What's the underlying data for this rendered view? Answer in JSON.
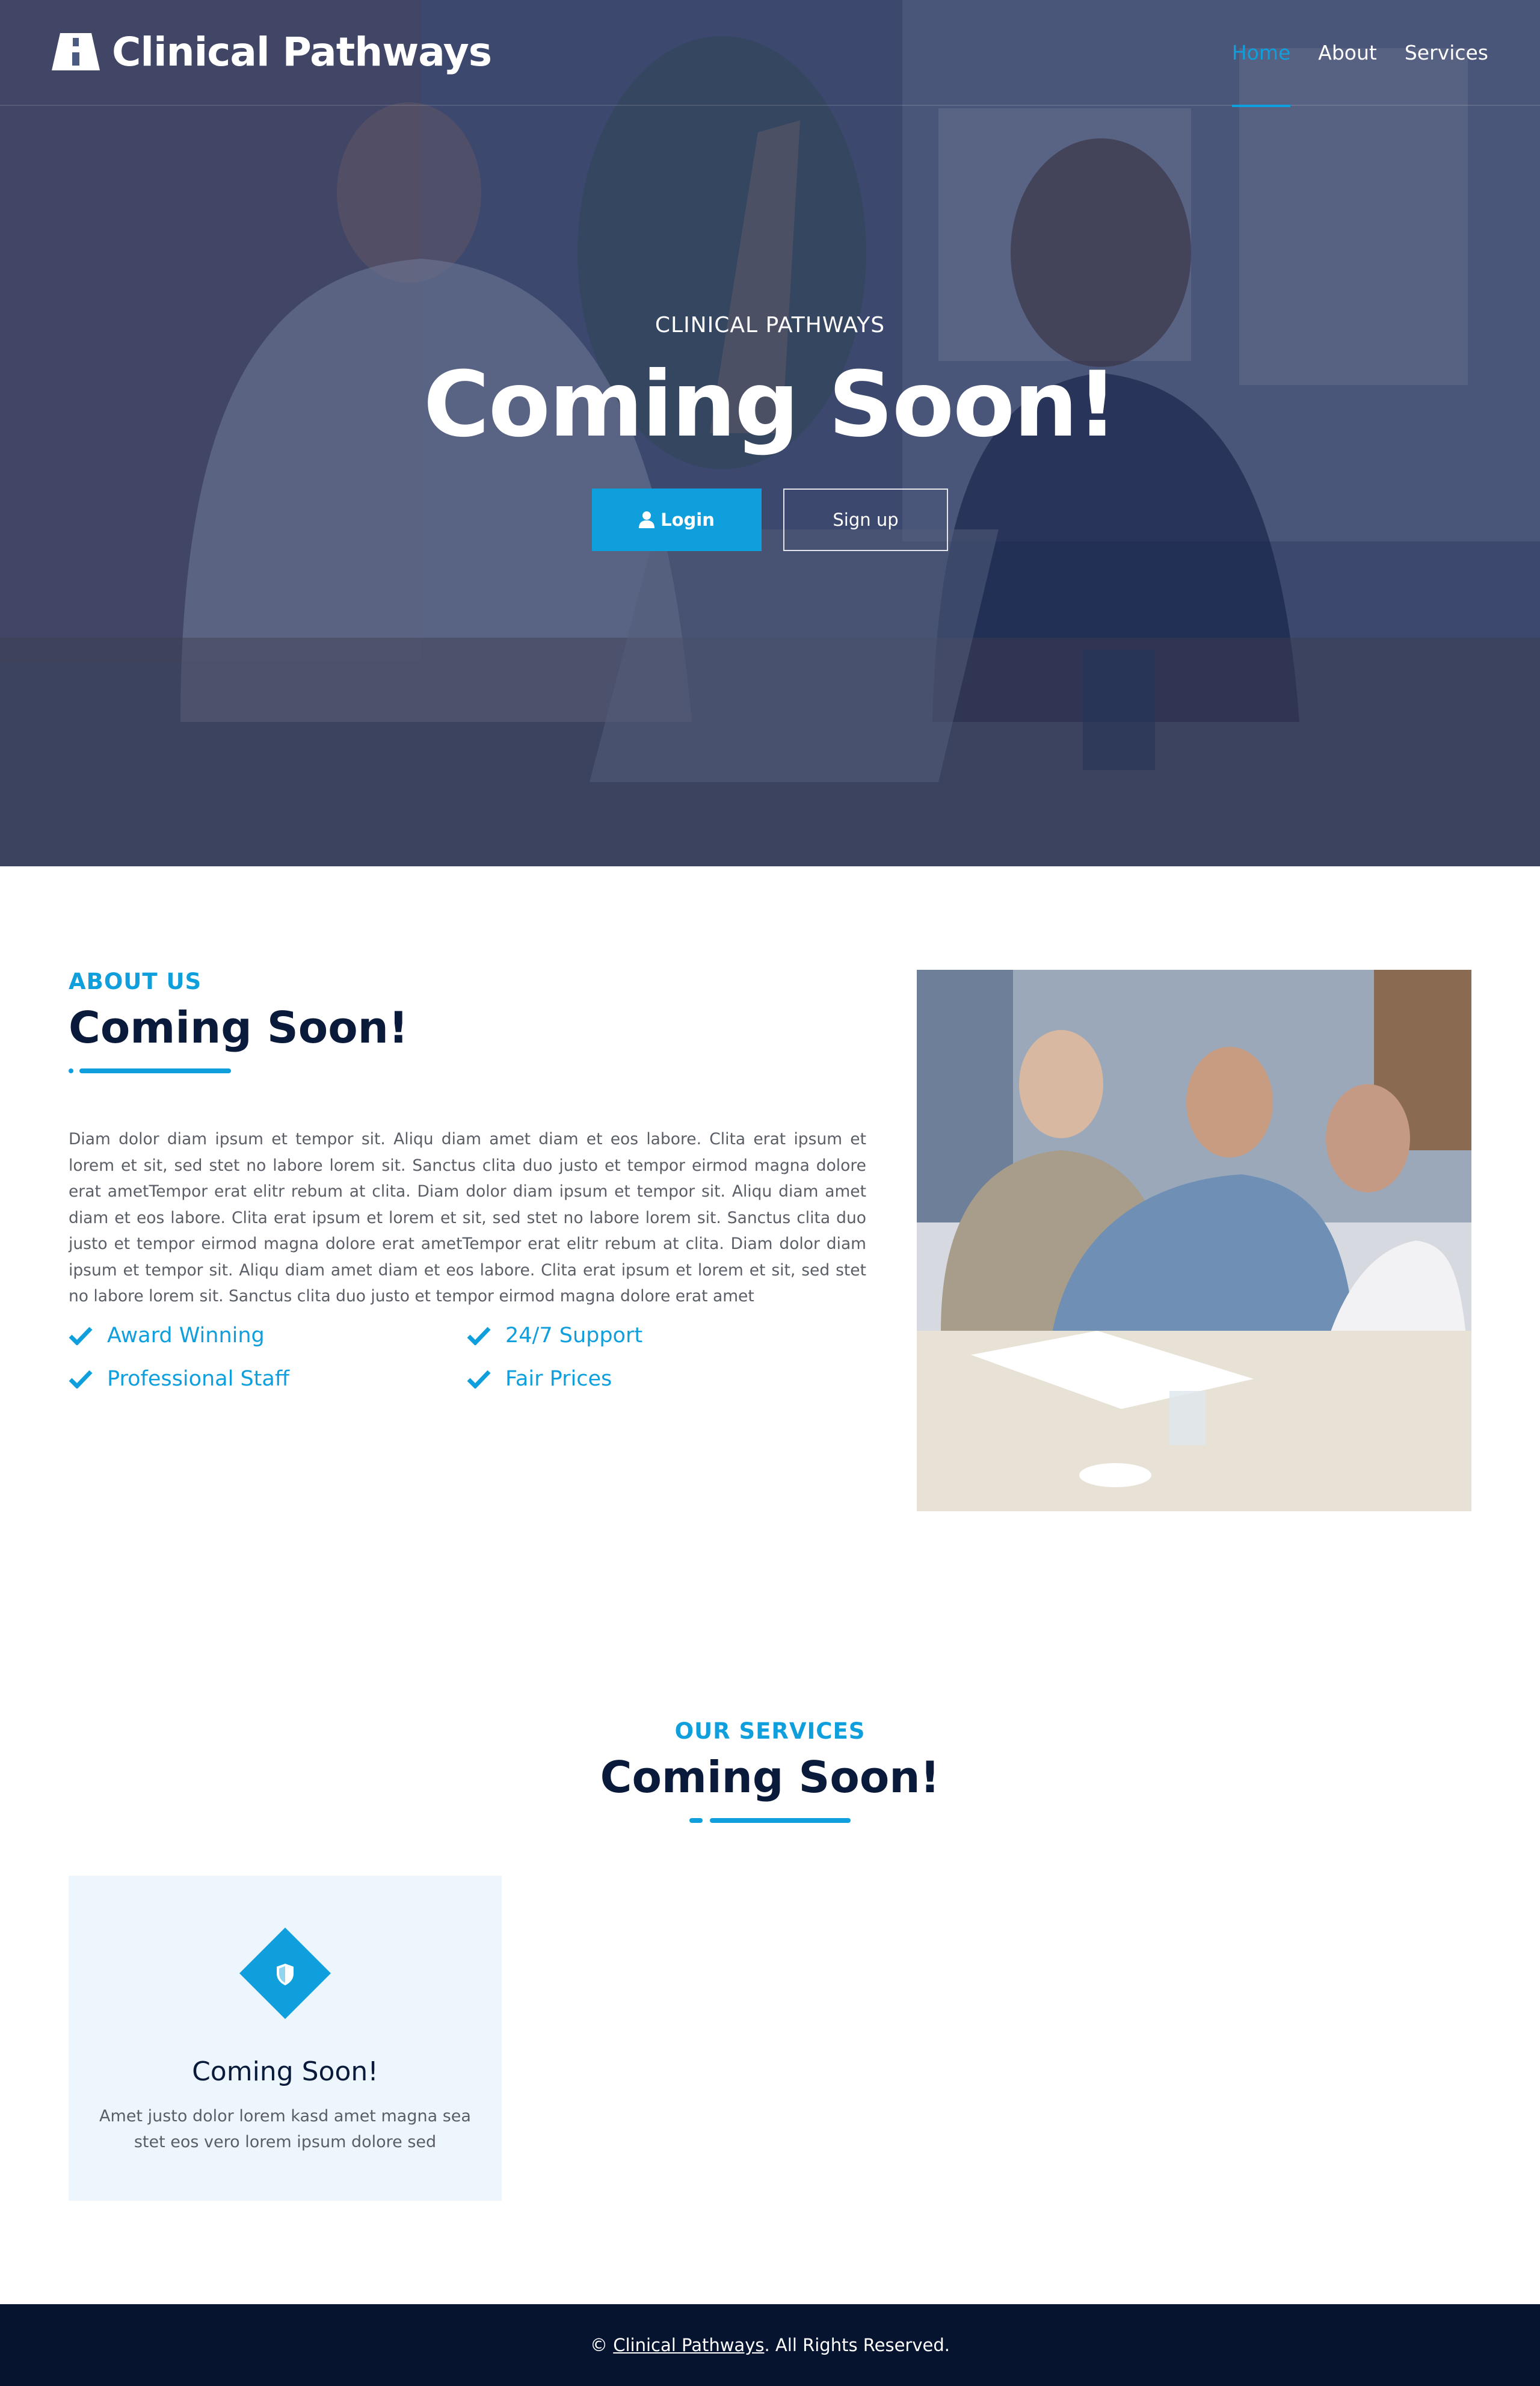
{
  "brand": {
    "name": "Clinical Pathways",
    "icon": "road-icon"
  },
  "nav": {
    "items": [
      {
        "label": "Home",
        "active": true
      },
      {
        "label": "About",
        "active": false
      },
      {
        "label": "Services",
        "active": false
      }
    ]
  },
  "hero": {
    "kicker": "CLINICAL PATHWAYS",
    "title": "Coming Soon!",
    "login_label": "Login",
    "login_icon": "user-icon",
    "signup_label": "Sign up"
  },
  "about": {
    "kicker": "ABOUT US",
    "title": "Coming Soon!",
    "text": "Diam dolor diam ipsum et tempor sit. Aliqu diam amet diam et eos labore. Clita erat ipsum et lorem et sit, sed stet no labore lorem sit. Sanctus clita duo justo et tempor eirmod magna dolore erat ametTempor erat elitr rebum at clita. Diam dolor diam ipsum et tempor sit. Aliqu diam amet diam et eos labore. Clita erat ipsum et lorem et sit, sed stet no labore lorem sit. Sanctus clita duo justo et tempor eirmod magna dolore erat ametTempor erat elitr rebum at clita. Diam dolor diam ipsum et tempor sit. Aliqu diam amet diam et eos labore. Clita erat ipsum et lorem et sit, sed stet no labore lorem sit. Sanctus clita duo justo et tempor eirmod magna dolore erat amet",
    "features": [
      "Award Winning",
      "24/7 Support",
      "Professional Staff",
      "Fair Prices"
    ]
  },
  "services": {
    "kicker": "OUR SERVICES",
    "title": "Coming Soon!",
    "cards": [
      {
        "icon": "shield-icon",
        "title": "Coming Soon!",
        "text": "Amet justo dolor lorem kasd amet magna sea stet eos vero lorem ipsum dolore sed"
      }
    ]
  },
  "footer": {
    "prefix": "©",
    "link": "Clinical Pathways",
    "suffix": ". All Rights Reserved."
  },
  "colors": {
    "accent": "#0f9fdc",
    "heading": "#0a1a3a",
    "footer_bg": "#061430",
    "card_bg": "#edf6fc"
  }
}
